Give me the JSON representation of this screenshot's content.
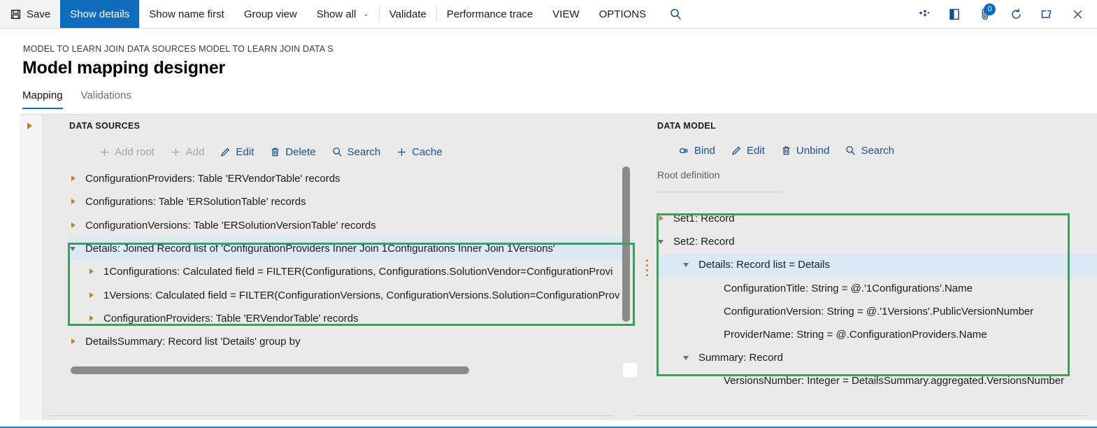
{
  "command_bar": {
    "items": [
      {
        "label": "Save",
        "icon": "save-icon",
        "active": false,
        "sep_after": false
      },
      {
        "label": "Show details",
        "icon": null,
        "active": true,
        "sep_after": false
      },
      {
        "label": "Show name first",
        "icon": null,
        "active": false,
        "sep_after": false
      },
      {
        "label": "Group view",
        "icon": null,
        "active": false,
        "sep_after": false
      },
      {
        "label": "Show all",
        "icon": "chevron-down-icon",
        "active": false,
        "sep_after": true
      },
      {
        "label": "Validate",
        "icon": null,
        "active": false,
        "sep_after": true
      },
      {
        "label": "Performance trace",
        "icon": null,
        "active": false,
        "sep_after": false
      },
      {
        "label": "VIEW",
        "icon": null,
        "active": false,
        "sep_after": false
      },
      {
        "label": "OPTIONS",
        "icon": null,
        "active": false,
        "sep_after": false
      }
    ],
    "search_icon": "search-icon",
    "right_icons": [
      {
        "name": "diamond-settings-icon",
        "badge": null
      },
      {
        "name": "book-open-icon",
        "badge": null
      },
      {
        "name": "attachment-icon",
        "badge": "0"
      },
      {
        "name": "refresh-icon",
        "badge": null
      },
      {
        "name": "popout-icon",
        "badge": null
      },
      {
        "name": "close-icon",
        "badge": null
      }
    ]
  },
  "header": {
    "breadcrumb": "MODEL TO LEARN JOIN DATA SOURCES MODEL TO LEARN JOIN DATA S",
    "title": "Model mapping designer"
  },
  "tabs": [
    {
      "label": "Mapping",
      "selected": true
    },
    {
      "label": "Validations",
      "selected": false
    }
  ],
  "data_sources": {
    "section_title": "DATA SOURCES",
    "toolbar": [
      {
        "label": "Add root",
        "icon": "plus-icon",
        "disabled": true
      },
      {
        "label": "Add",
        "icon": "plus-icon",
        "disabled": true
      },
      {
        "label": "Edit",
        "icon": "pencil-icon",
        "disabled": false
      },
      {
        "label": "Delete",
        "icon": "trash-icon",
        "disabled": false
      },
      {
        "label": "Search",
        "icon": "search-icon",
        "disabled": false
      },
      {
        "label": "Cache",
        "icon": "plus-icon",
        "disabled": false
      }
    ],
    "tree": [
      {
        "label": "ConfigurationProviders: Table 'ERVendorTable' records",
        "indent": 0,
        "twisty": "collapsed",
        "selected": false
      },
      {
        "label": "Configurations: Table 'ERSolutionTable' records",
        "indent": 0,
        "twisty": "collapsed",
        "selected": false
      },
      {
        "label": "ConfigurationVersions: Table 'ERSolutionVersionTable' records",
        "indent": 0,
        "twisty": "collapsed",
        "selected": false
      },
      {
        "label": "Details: Joined Record list of 'ConfigurationProviders Inner Join 1Configurations Inner Join 1Versions'",
        "indent": 0,
        "twisty": "expanded",
        "selected": true
      },
      {
        "label": "1Configurations: Calculated field = FILTER(Configurations, Configurations.SolutionVendor=ConfigurationProvi",
        "indent": 1,
        "twisty": "collapsed",
        "selected": false
      },
      {
        "label": "1Versions: Calculated field = FILTER(ConfigurationVersions, ConfigurationVersions.Solution=ConfigurationProv",
        "indent": 1,
        "twisty": "collapsed",
        "selected": false
      },
      {
        "label": "ConfigurationProviders: Table 'ERVendorTable' records",
        "indent": 1,
        "twisty": "collapsed",
        "selected": false
      },
      {
        "label": "DetailsSummary: Record list 'Details' group by",
        "indent": 0,
        "twisty": "collapsed",
        "selected": false
      }
    ]
  },
  "data_model": {
    "section_title": "DATA MODEL",
    "toolbar": [
      {
        "label": "Bind",
        "icon": "link-icon",
        "disabled": false
      },
      {
        "label": "Edit",
        "icon": "pencil-icon",
        "disabled": false
      },
      {
        "label": "Unbind",
        "icon": "trash-icon",
        "disabled": false
      },
      {
        "label": "Search",
        "icon": "search-icon",
        "disabled": false
      }
    ],
    "root_definition_label": "Root definition",
    "tree": [
      {
        "label": "Set1: Record",
        "indent": 0,
        "twisty": "collapsed",
        "selected": false
      },
      {
        "label": "Set2: Record",
        "indent": 0,
        "twisty": "expanded",
        "selected": false
      },
      {
        "label": "Details: Record list = Details",
        "indent": 1,
        "twisty": "expanded",
        "selected": true
      },
      {
        "label": "ConfigurationTitle: String = @.'1Configurations'.Name",
        "indent": 2,
        "twisty": "none",
        "selected": false
      },
      {
        "label": "ConfigurationVersion: String = @.'1Versions'.PublicVersionNumber",
        "indent": 2,
        "twisty": "none",
        "selected": false
      },
      {
        "label": "ProviderName: String = @.ConfigurationProviders.Name",
        "indent": 2,
        "twisty": "none",
        "selected": false
      },
      {
        "label": "Summary: Record",
        "indent": 1,
        "twisty": "expanded",
        "selected": false
      },
      {
        "label": "VersionsNumber: Integer = DetailsSummary.aggregated.VersionsNumber",
        "indent": 2,
        "twisty": "none",
        "selected": false
      }
    ]
  },
  "colors": {
    "accent_blue": "#0f6cbd",
    "link_blue": "#1b4f8a",
    "highlight_green": "#21b04b",
    "selected_row_blue": "#dbe9f7",
    "panel_bg": "#eaeaea"
  }
}
